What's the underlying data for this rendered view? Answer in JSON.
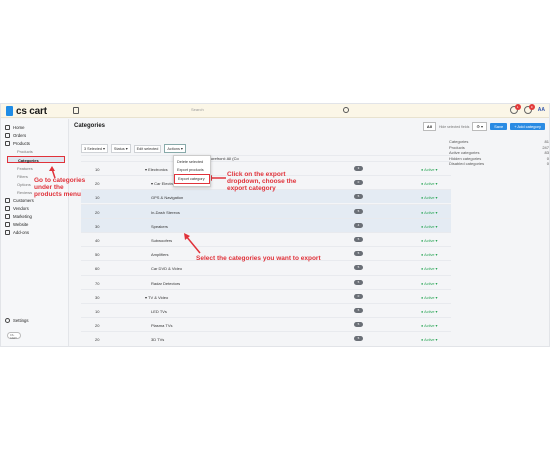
{
  "topbar": {
    "logo": "cs cart",
    "search_placeholder": "Search",
    "notif_count_1": "1",
    "notif_count_2": "9",
    "user_initials": "AA"
  },
  "sidebar": {
    "items": [
      {
        "label": "Home"
      },
      {
        "label": "Orders"
      },
      {
        "label": "Products"
      },
      {
        "label": "Customers"
      },
      {
        "label": "Vendors"
      },
      {
        "label": "Marketing"
      },
      {
        "label": "Website"
      },
      {
        "label": "Add-ons"
      }
    ],
    "sub": [
      "Products",
      "Categories",
      "Features",
      "Filters",
      "Options",
      "Reviews"
    ],
    "settings": "Settings",
    "toggle_text": "CS-CART"
  },
  "header": {
    "title": "Categories",
    "all_btn": "All",
    "columns_text": "Hide selected fields",
    "save_btn": "Save",
    "add_btn": "+ Add category"
  },
  "toolbar": {
    "selected": "3 Selected ▾",
    "status": "Status ▾",
    "edit_selected": "Edit selected",
    "actions": "Actions ▾"
  },
  "dropdown": [
    "Delete selected",
    "Export products",
    "Export category"
  ],
  "rows": [
    {
      "pos": "",
      "name": "▾ Storefront: All (Co",
      "count": "",
      "status": "",
      "sel": false
    },
    {
      "pos": "10",
      "name": "▾ Electronics",
      "count": "3",
      "status": "● Active ▾",
      "sel": false
    },
    {
      "pos": "20",
      "name": "▾ Car Electronics",
      "count": "0",
      "status": "● Active ▾",
      "sel": false
    },
    {
      "pos": "10",
      "name": "GPS & Navigation",
      "count": "5",
      "status": "● Active ▾",
      "sel": true
    },
    {
      "pos": "20",
      "name": "In-Dash Stereos",
      "count": "5",
      "status": "● Active ▾",
      "sel": true
    },
    {
      "pos": "30",
      "name": "Speakers",
      "count": "4",
      "status": "● Active ▾",
      "sel": true
    },
    {
      "pos": "40",
      "name": "Subwoofers",
      "count": "5",
      "status": "● Active ▾",
      "sel": false
    },
    {
      "pos": "50",
      "name": "Amplifiers",
      "count": "5",
      "status": "● Active ▾",
      "sel": false
    },
    {
      "pos": "60",
      "name": "Car DVD & Video",
      "count": "5",
      "status": "● Active ▾",
      "sel": false
    },
    {
      "pos": "70",
      "name": "Radar Detectors",
      "count": "5",
      "status": "● Active ▾",
      "sel": false
    },
    {
      "pos": "30",
      "name": "▾ TV & Video",
      "count": "0",
      "status": "● Active ▾",
      "sel": false
    },
    {
      "pos": "10",
      "name": "LED TVs",
      "count": "5",
      "status": "● Active ▾",
      "sel": false
    },
    {
      "pos": "20",
      "name": "Plasma TVs",
      "count": "5",
      "status": "● Active ▾",
      "sel": false
    },
    {
      "pos": "20",
      "name": "3D TVs",
      "count": "5",
      "status": "● Active ▾",
      "sel": false
    }
  ],
  "summary": [
    {
      "label": "Categories",
      "value": "81"
    },
    {
      "label": "Products",
      "value": "247"
    },
    {
      "label": "Active categories",
      "value": "83"
    },
    {
      "label": "Hidden categories",
      "value": "0"
    },
    {
      "label": "Disabled categories",
      "value": "0"
    }
  ],
  "annotations": {
    "sidebar_note": "Go to categories\nunder the\nproducts menu",
    "export_note": "Click on the export\ndropdown, choose the\nexport category",
    "select_note": "Select the categories you want to export"
  },
  "colors": {
    "accent": "#2a8be3",
    "annotation": "#e0323a",
    "active": "#2ba657"
  }
}
